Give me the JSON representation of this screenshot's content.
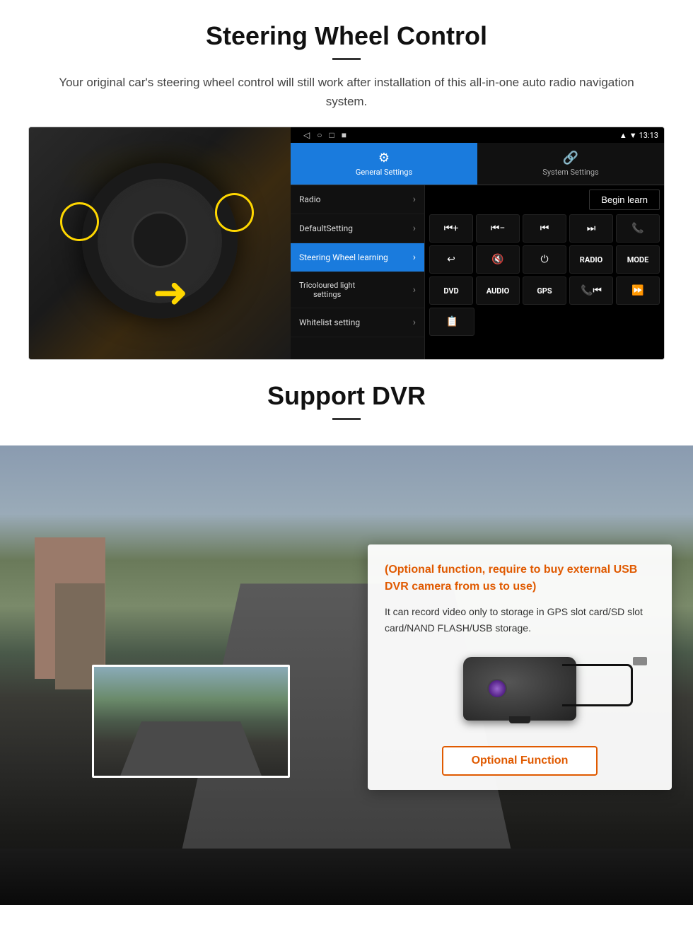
{
  "steering_section": {
    "title": "Steering Wheel Control",
    "subtitle": "Your original car's steering wheel control will still work after installation of this all-in-one auto radio navigation system.",
    "status_bar": {
      "time": "13:13",
      "nav_icons": [
        "◁",
        "○",
        "□",
        "■"
      ]
    },
    "tabs": [
      {
        "id": "general",
        "icon": "⚙",
        "label": "General Settings",
        "active": true
      },
      {
        "id": "system",
        "icon": "🌐",
        "label": "System Settings",
        "active": false
      }
    ],
    "menu_items": [
      {
        "label": "Radio",
        "active": false
      },
      {
        "label": "DefaultSetting",
        "active": false
      },
      {
        "label": "Steering Wheel learning",
        "active": true
      },
      {
        "label": "Tricoloured light settings",
        "active": false
      },
      {
        "label": "Whitelist setting",
        "active": false
      }
    ],
    "begin_learn": "Begin learn",
    "control_buttons_row1": [
      "⏮+",
      "⏮-",
      "⏮",
      "⏭",
      "📞"
    ],
    "control_buttons_row2": [
      "📞↩",
      "🔇x",
      "⏻",
      "RADIO",
      "MODE"
    ],
    "control_buttons_row3": [
      "DVD",
      "AUDIO",
      "GPS",
      "📞⏮",
      "⏩⏭"
    ],
    "control_buttons_row4": [
      "📋"
    ]
  },
  "dvr_section": {
    "title": "Support DVR",
    "optional_text": "(Optional function, require to buy external USB DVR camera from us to use)",
    "description": "It can record video only to storage in GPS slot card/SD slot card/NAND FLASH/USB storage.",
    "optional_button": "Optional Function"
  }
}
